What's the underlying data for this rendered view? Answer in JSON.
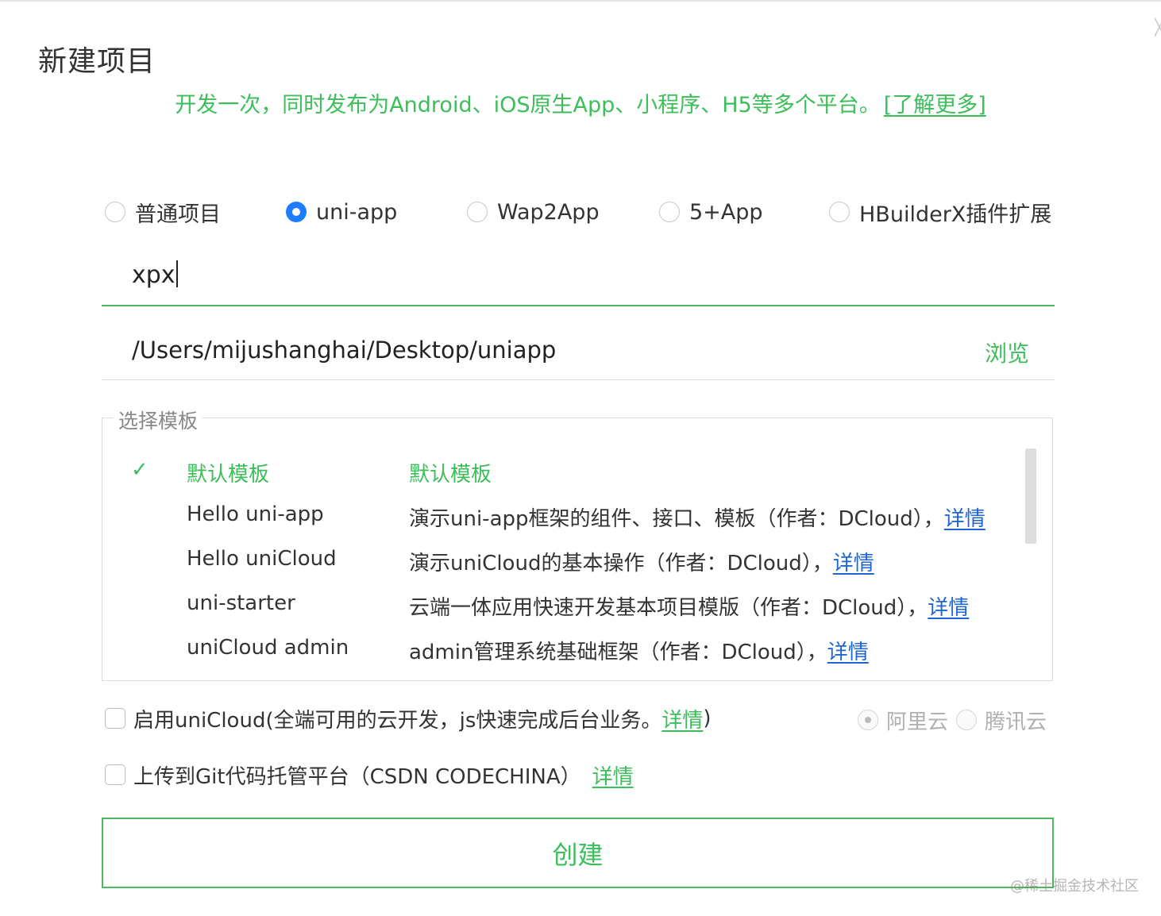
{
  "dialog": {
    "title": "新建项目",
    "subtitle": "开发一次，同时发布为Android、iOS原生App、小程序、H5等多个平台。",
    "learn_more": "[了解更多]"
  },
  "project_types": [
    {
      "label": "普通项目",
      "selected": false
    },
    {
      "label": "uni-app",
      "selected": true
    },
    {
      "label": "Wap2App",
      "selected": false
    },
    {
      "label": "5+App",
      "selected": false
    },
    {
      "label": "HBuilderX插件扩展",
      "selected": false
    }
  ],
  "project_name": {
    "value": "xpx"
  },
  "location": {
    "value": "/Users/mijushanghai/Desktop/uniapp",
    "browse_label": "浏览"
  },
  "templates": {
    "legend": "选择模板",
    "check_mark": "✓",
    "items": [
      {
        "name": "默认模板",
        "description": "默认模板",
        "link": "",
        "selected": true
      },
      {
        "name": "Hello uni-app",
        "description": "演示uni-app框架的组件、接口、模板（作者：DCloud），",
        "link": "详情",
        "selected": false
      },
      {
        "name": "Hello uniCloud",
        "description": "演示uniCloud的基本操作（作者：DCloud），",
        "link": "详情",
        "selected": false
      },
      {
        "name": "uni-starter",
        "description": "云端一体应用快速开发基本项目模版（作者：DCloud），",
        "link": "详情",
        "selected": false
      },
      {
        "name": "uniCloud admin",
        "description": "admin管理系统基础框架（作者：DCloud），",
        "link": "详情",
        "selected": false
      }
    ]
  },
  "unicloud": {
    "label_prefix": "启用uniCloud(全端可用的云开发，js快速完成后台业务。",
    "link": "详情",
    "label_suffix": ")",
    "providers": [
      {
        "label": "阿里云",
        "selected": true
      },
      {
        "label": "腾讯云",
        "selected": false
      }
    ]
  },
  "git": {
    "label": "上传到Git代码托管平台（CSDN CODECHINA）",
    "link": "详情"
  },
  "create_button": {
    "label": "创建"
  },
  "watermark": "@稀土掘金技术社区",
  "colors": {
    "accent_green": "#3cbe5a",
    "radio_blue": "#1e7cff",
    "link_blue": "#1e66d6"
  }
}
